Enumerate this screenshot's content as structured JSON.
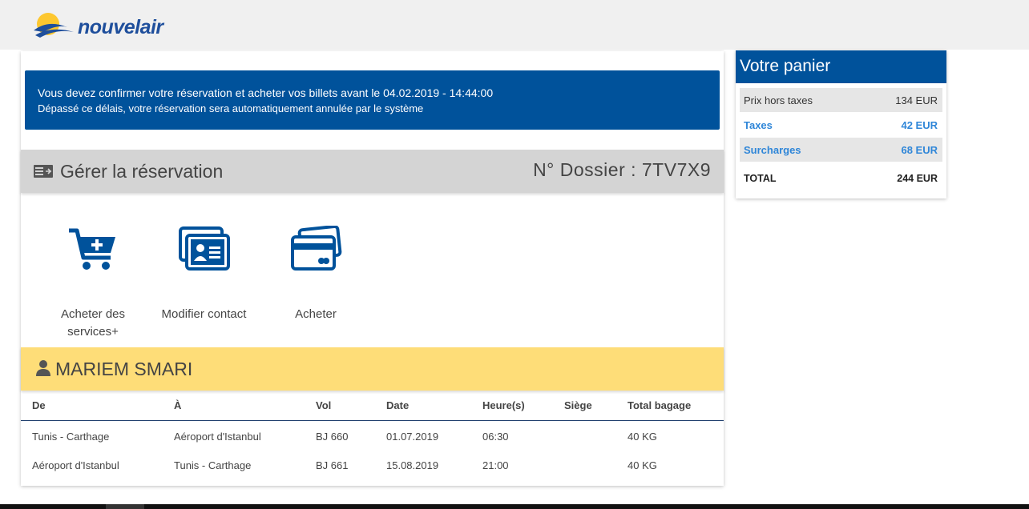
{
  "brand": {
    "name": "nouvelair"
  },
  "alert": {
    "line1": "Vous devez confirmer votre réservation et acheter vos billets avant le 04.02.2019 - 14:44:00",
    "line2": "Dépassé ce délais, votre réservation sera automatiquement annulée par le système"
  },
  "manage": {
    "title": "Gérer la réservation",
    "dossier": "N° Dossier : 7TV7X9"
  },
  "actions": [
    {
      "label_line1": "Acheter des",
      "label_line2": "services+",
      "icon": "cart-plus-icon"
    },
    {
      "label": "Modifier contact",
      "icon": "contact-card-icon"
    },
    {
      "label": "Acheter",
      "icon": "credit-cards-icon"
    }
  ],
  "passenger": {
    "name": "MARIEM SMARI",
    "icon": "user-icon"
  },
  "flights": {
    "headers": [
      "De",
      "À",
      "Vol",
      "Date",
      "Heure(s)",
      "Siège",
      "Total bagage"
    ],
    "rows": [
      [
        "Tunis - Carthage",
        "Aéroport d'Istanbul",
        "BJ 660",
        "01.07.2019",
        "06:30",
        "",
        "40 KG"
      ],
      [
        "Aéroport d'Istanbul",
        "Tunis - Carthage",
        "BJ 661",
        "15.08.2019",
        "21:00",
        "",
        "40 KG"
      ]
    ]
  },
  "cart": {
    "title": "Votre panier",
    "rows": [
      {
        "label": "Prix hors taxes",
        "value": "134 EUR"
      },
      {
        "label": "Taxes",
        "value": "42 EUR"
      },
      {
        "label": "Surcharges",
        "value": "68 EUR"
      },
      {
        "label": "TOTAL",
        "value": "244 EUR"
      }
    ]
  },
  "colors": {
    "primary": "#00529b",
    "yellow": "#fedd78",
    "grey": "#d4d4d4",
    "link": "#2f86d8"
  }
}
